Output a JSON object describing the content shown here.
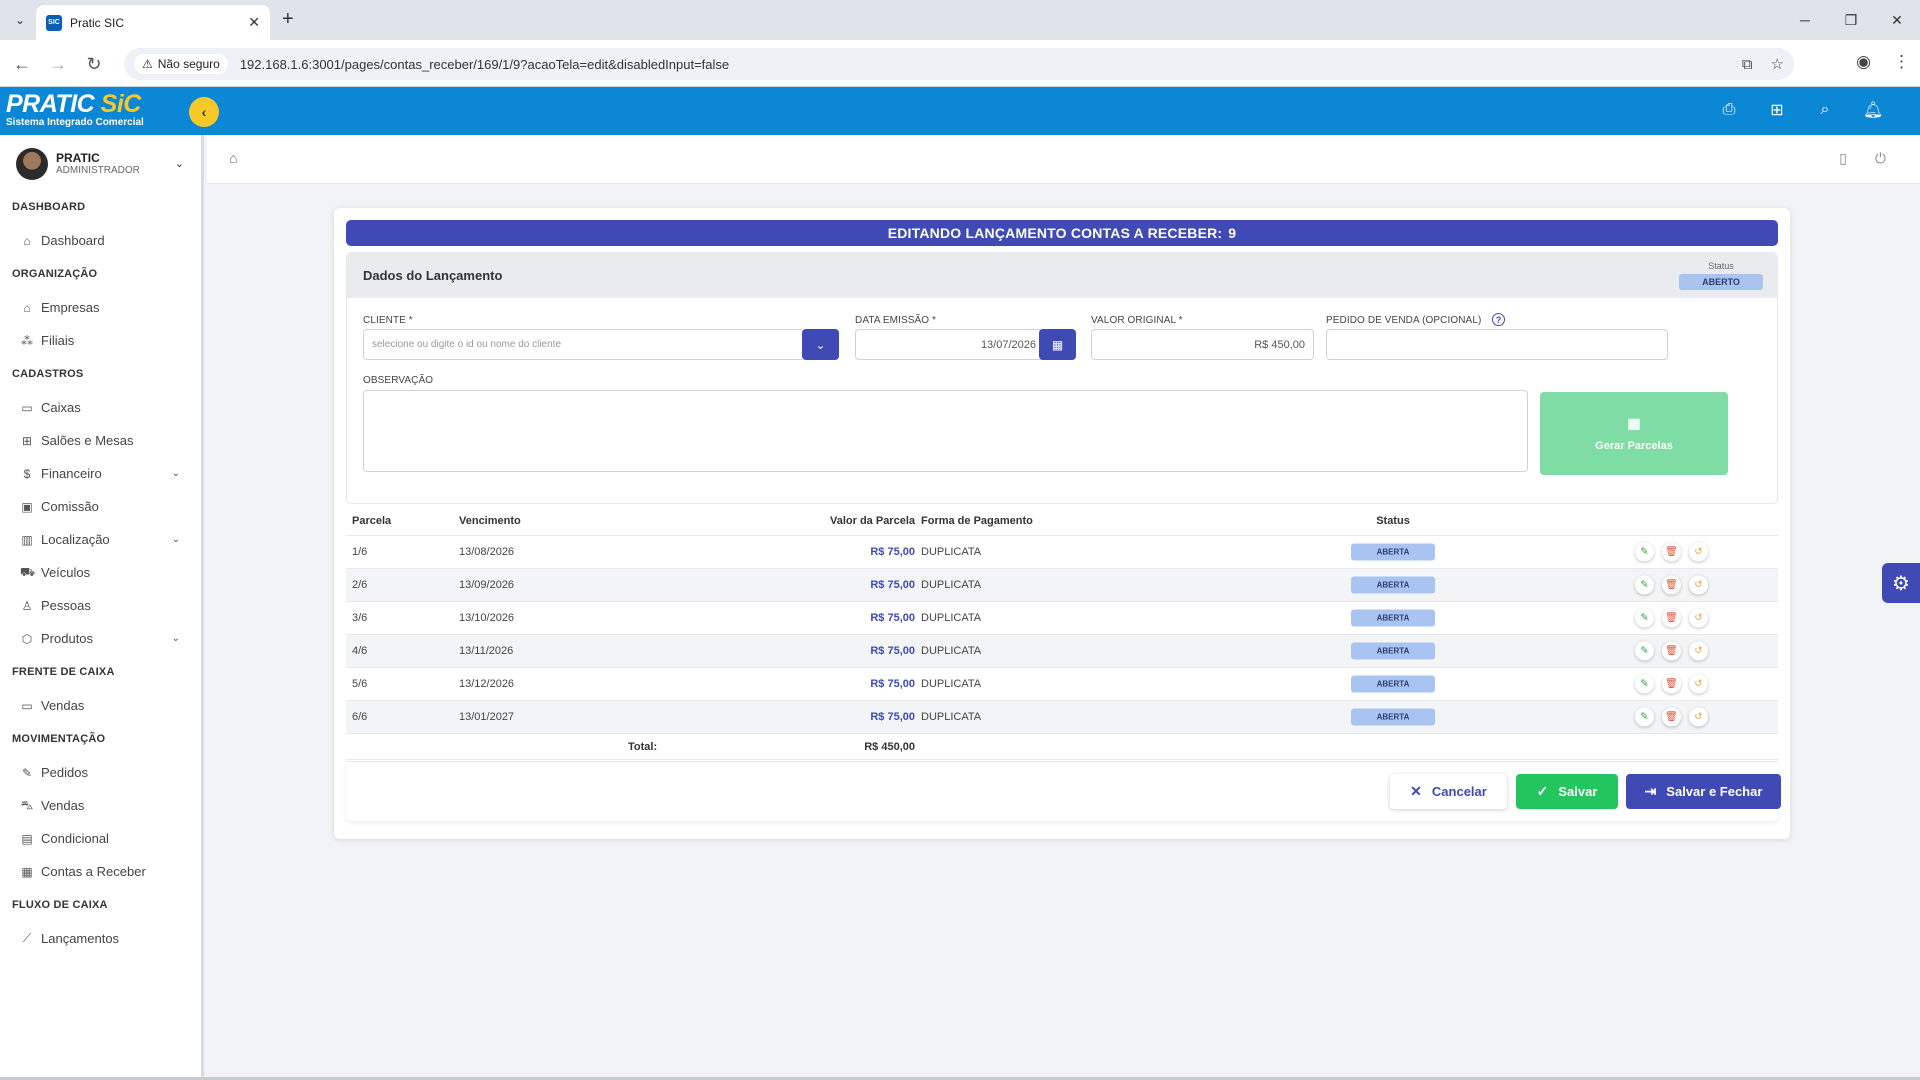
{
  "browser": {
    "tab_title": "Pratic SIC",
    "tab_favicon": "SIC",
    "security_label": "Não seguro",
    "url": "192.168.1.6:3001/pages/contas_receber/169/1/9?acaoTela=edit&disabledInput=false"
  },
  "header": {
    "logo_main": "PRATIC",
    "logo_accent": "SiC",
    "logo_sub": "Sistema Integrado Comercial",
    "accent_color": "#f7c928",
    "brand_color": "#0c87d6"
  },
  "user": {
    "name": "PRATIC",
    "role": "ADMINISTRADOR"
  },
  "sidebar": {
    "sections": [
      {
        "title": "DASHBOARD",
        "items": [
          {
            "label": "Dashboard",
            "icon": "home-icon",
            "glyph": "⌂"
          }
        ]
      },
      {
        "title": "ORGANIZAÇÃO",
        "items": [
          {
            "label": "Empresas",
            "icon": "building-icon",
            "glyph": "⌂"
          },
          {
            "label": "Filiais",
            "icon": "sitemap-icon",
            "glyph": "⁂"
          }
        ]
      },
      {
        "title": "CADASTROS",
        "items": [
          {
            "label": "Caixas",
            "icon": "monitor-icon",
            "glyph": "▭"
          },
          {
            "label": "Salões e Mesas",
            "icon": "grid-icon",
            "glyph": "⊞"
          },
          {
            "label": "Financeiro",
            "icon": "dollar-icon",
            "glyph": "$",
            "chevron": true
          },
          {
            "label": "Comissão",
            "icon": "money-icon",
            "glyph": "▣"
          },
          {
            "label": "Localização",
            "icon": "map-icon",
            "glyph": "▥",
            "chevron": true
          },
          {
            "label": "Veículos",
            "icon": "car-icon",
            "glyph": "⛟"
          },
          {
            "label": "Pessoas",
            "icon": "user-icon",
            "glyph": "♙"
          },
          {
            "label": "Produtos",
            "icon": "box-icon",
            "glyph": "⬡",
            "chevron": true
          }
        ]
      },
      {
        "title": "FRENTE DE CAIXA",
        "items": [
          {
            "label": "Vendas",
            "icon": "monitor-icon",
            "glyph": "▭"
          }
        ]
      },
      {
        "title": "MOVIMENTAÇÃO",
        "items": [
          {
            "label": "Pedidos",
            "icon": "file-edit-icon",
            "glyph": "✎"
          },
          {
            "label": "Vendas",
            "icon": "cart-icon",
            "glyph": "⛍"
          },
          {
            "label": "Condicional",
            "icon": "briefcase-icon",
            "glyph": "▤"
          },
          {
            "label": "Contas a Receber",
            "icon": "receipt-icon",
            "glyph": "▦"
          }
        ]
      },
      {
        "title": "FLUXO DE CAIXA",
        "items": [
          {
            "label": "Lançamentos",
            "icon": "chart-line-icon",
            "glyph": "⟋"
          }
        ]
      }
    ]
  },
  "page": {
    "title": "EDITANDO LANÇAMENTO CONTAS A RECEBER:",
    "record_number": "9",
    "section_title": "Dados do Lançamento",
    "status_label": "Status",
    "status_value": "ABERTO",
    "status_color": "#a9c4f1",
    "form": {
      "cliente_label": "CLIENTE *",
      "cliente_placeholder": "selecione ou digite o id ou nome do cliente",
      "data_label": "DATA EMISSÃO *",
      "data_value": "13/07/2026",
      "valor_label": "VALOR ORIGINAL *",
      "valor_value": "R$ 450,00",
      "pedido_label": "PEDIDO DE VENDA (OPCIONAL)",
      "pedido_value": "",
      "obs_label": "OBSERVAÇÃO",
      "obs_value": "",
      "gerar_label": "Gerar Parcelas"
    },
    "table": {
      "headers": [
        "Parcela",
        "Vencimento",
        "Valor da Parcela",
        "Forma de Pagamento",
        "Status"
      ],
      "rows": [
        {
          "parcela": "1/6",
          "vencimento": "13/08/2026",
          "valor": "R$ 75,00",
          "forma": "DUPLICATA",
          "status": "ABERTA"
        },
        {
          "parcela": "2/6",
          "vencimento": "13/09/2026",
          "valor": "R$ 75,00",
          "forma": "DUPLICATA",
          "status": "ABERTA"
        },
        {
          "parcela": "3/6",
          "vencimento": "13/10/2026",
          "valor": "R$ 75,00",
          "forma": "DUPLICATA",
          "status": "ABERTA"
        },
        {
          "parcela": "4/6",
          "vencimento": "13/11/2026",
          "valor": "R$ 75,00",
          "forma": "DUPLICATA",
          "status": "ABERTA"
        },
        {
          "parcela": "5/6",
          "vencimento": "13/12/2026",
          "valor": "R$ 75,00",
          "forma": "DUPLICATA",
          "status": "ABERTA"
        },
        {
          "parcela": "6/6",
          "vencimento": "13/01/2027",
          "valor": "R$ 75,00",
          "forma": "DUPLICATA",
          "status": "ABERTA"
        }
      ],
      "total_label": "Total:",
      "total_value": "R$ 450,00"
    },
    "buttons": {
      "cancel": "Cancelar",
      "save": "Salvar",
      "save_close": "Salvar e Fechar"
    }
  }
}
